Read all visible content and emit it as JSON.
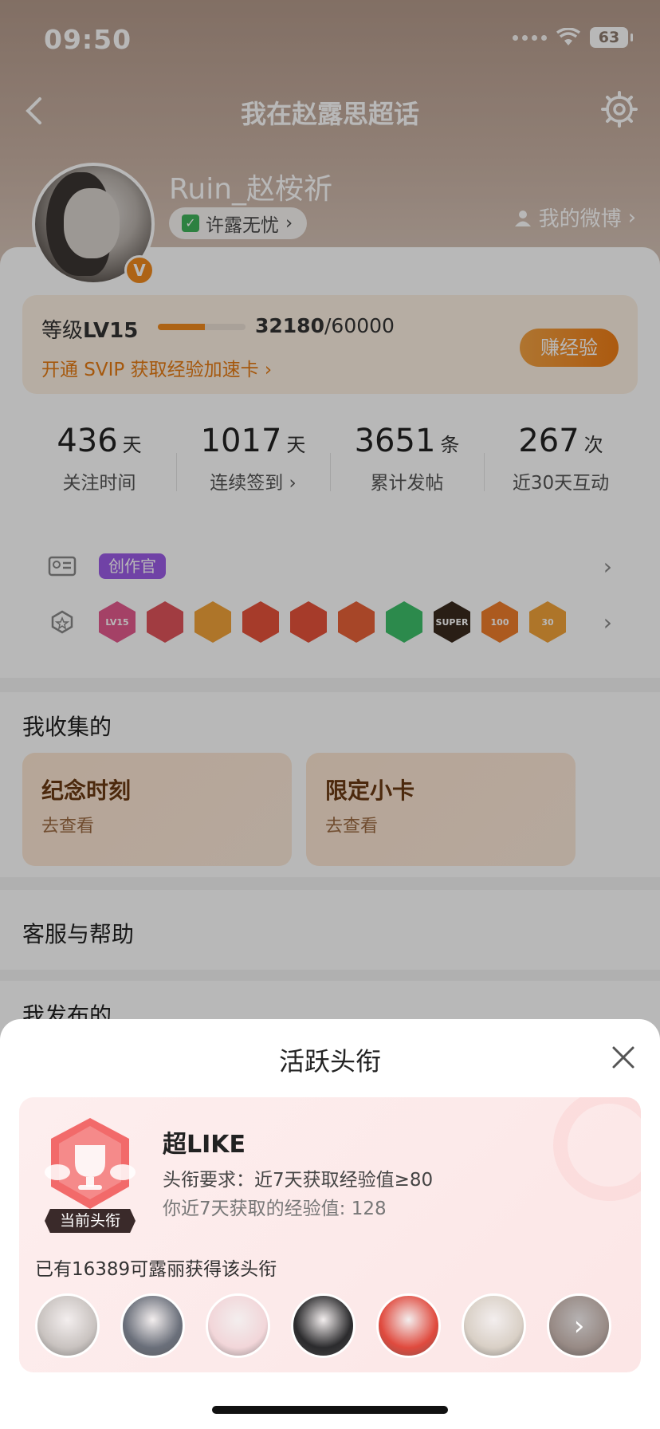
{
  "status": {
    "time": "09:50",
    "battery": "63"
  },
  "nav": {
    "title": "我在赵露思超话"
  },
  "profile": {
    "username": "Ruin_赵桉祈",
    "tag": "许露无忧",
    "tag_chevron": "›",
    "my_weibo": "我的微博",
    "verified_mark": "V"
  },
  "level": {
    "label_prefix": "等级",
    "level": "LV15",
    "current": "32180",
    "total": "/60000",
    "progress": 0.536,
    "svip_text": "开通 SVIP 获取经验加速卡 ›",
    "earn_button": "赚经验"
  },
  "stats": [
    {
      "value": "436",
      "unit": "天",
      "label": "关注时间"
    },
    {
      "value": "1017",
      "unit": "天",
      "label": "连续签到 ›"
    },
    {
      "value": "3651",
      "unit": "条",
      "label": "累计发帖"
    },
    {
      "value": "267",
      "unit": "次",
      "label": "近30天互动"
    }
  ],
  "creator_tag": "创作官",
  "medals": [
    {
      "label": "LV15",
      "color": "#e35a8e"
    },
    {
      "label": "",
      "color": "#e0545b"
    },
    {
      "label": "",
      "color": "#f2a23a"
    },
    {
      "label": "",
      "color": "#e6533b"
    },
    {
      "label": "",
      "color": "#e6533b"
    },
    {
      "label": "",
      "color": "#e86238"
    },
    {
      "label": "",
      "color": "#3ec06a"
    },
    {
      "label": "SUPER",
      "color": "#3a2a1e"
    },
    {
      "label": "100",
      "color": "#ef7d2c"
    },
    {
      "label": "30",
      "color": "#f2a23a"
    }
  ],
  "collect": {
    "title": "我收集的",
    "cards": [
      {
        "title": "纪念时刻",
        "sub": "去查看"
      },
      {
        "title": "限定小卡",
        "sub": "去查看"
      }
    ]
  },
  "help": {
    "title": "客服与帮助"
  },
  "published": {
    "title": "我发布的"
  },
  "sheet": {
    "title": "活跃头衔",
    "badge_name": "超LIKE",
    "requirement": "头衔要求：近7天获取经验值≥80",
    "your_exp": "你近7天获取的经验值: 128",
    "current_tag": "当前头衔",
    "holders_text": "已有16389可露丽获得该头衔",
    "holder_colors": [
      "#c9c3c0",
      "#6a6f7a",
      "#f2d6d9",
      "#2b2b2d",
      "#e04a3e",
      "#d9d0c6",
      "#cbb9b2"
    ],
    "more_chevron": "›"
  },
  "colors": {
    "accent": "#ef7d16",
    "creator": "#9b5ce6",
    "sheet_card": "#fdeeee"
  }
}
